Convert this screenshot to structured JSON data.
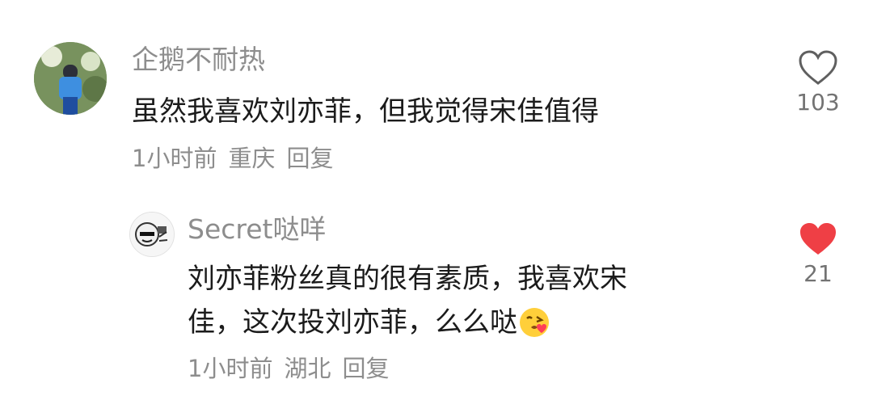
{
  "comments": [
    {
      "username": "企鹅不耐热",
      "text": "虽然我喜欢刘亦菲，但我觉得宋佳值得",
      "time": "1小时前",
      "location": "重庆",
      "reply_label": "回复",
      "likes": "103",
      "liked": false
    },
    {
      "username": "Secret哒咩",
      "text_line1": "刘亦菲粉丝真的很有素质，我喜欢宋",
      "text_line2": "佳，这次投刘亦菲，么么哒",
      "emoji": "kissing-face",
      "time": "1小时前",
      "location": "湖北",
      "reply_label": "回复",
      "likes": "21",
      "liked": true
    }
  ],
  "colors": {
    "liked_heart": "#ef3f45",
    "meta_text": "#8d8d8d",
    "body_text": "#1b1b1b"
  }
}
